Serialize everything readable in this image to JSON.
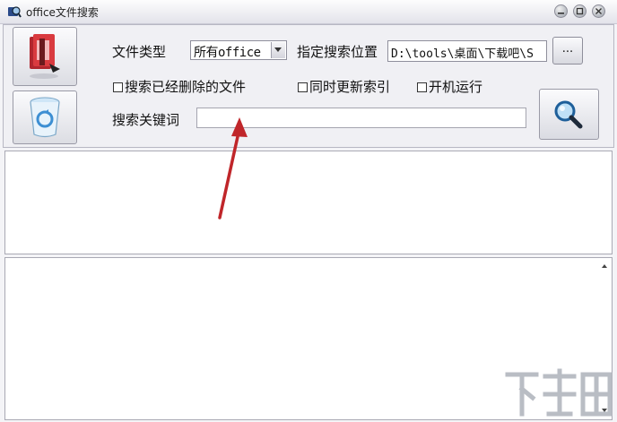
{
  "window": {
    "title": "office文件搜索"
  },
  "form": {
    "file_type_label": "文件类型",
    "file_type_value": "所有office",
    "location_label": "指定搜索位置",
    "location_value": "D:\\tools\\桌面\\下载吧\\S",
    "browse_label": "...",
    "keyword_label": "搜索关键词",
    "keyword_value": ""
  },
  "checkboxes": [
    {
      "label": "搜索已经删除的文件",
      "checked": false
    },
    {
      "label": "同时更新索引",
      "checked": false
    },
    {
      "label": "开机运行",
      "checked": false
    }
  ],
  "icons": {
    "app": "magnifier-app-icon",
    "office_files": "office-files-icon",
    "recycle_bin": "recycle-bin-icon",
    "search": "search-icon",
    "minimize": "minimize-icon",
    "maximize": "maximize-icon",
    "close": "close-icon"
  },
  "colors": {
    "annotation_arrow": "#c0262a"
  },
  "watermark": {
    "brand": "下载吧"
  }
}
